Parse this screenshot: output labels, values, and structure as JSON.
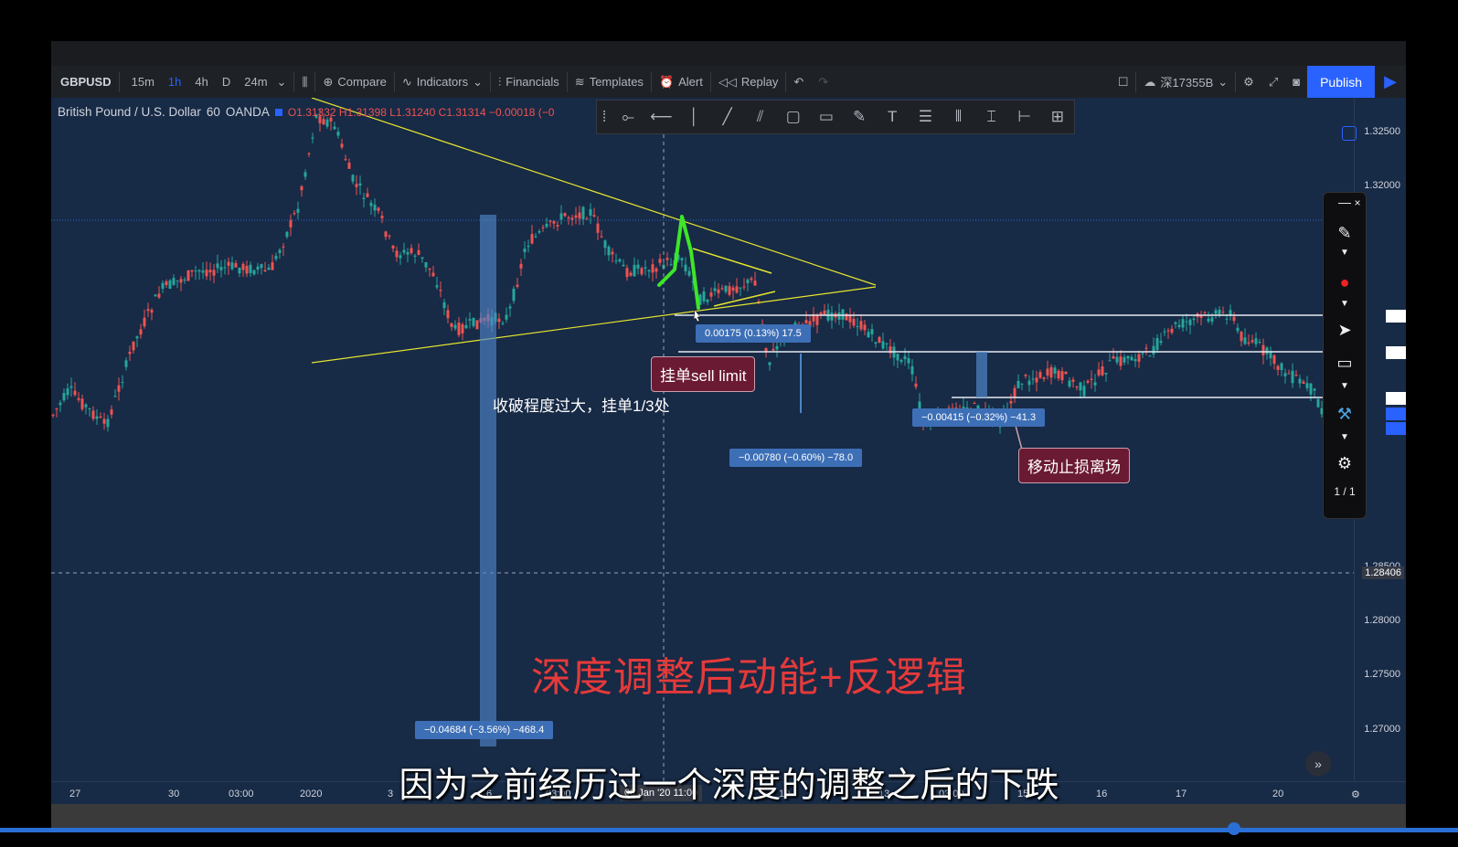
{
  "toolbar": {
    "symbol": "GBPUSD",
    "timeframes": [
      "15m",
      "1h",
      "4h",
      "D",
      "24m"
    ],
    "compare": "Compare",
    "indicators": "Indicators",
    "financials": "Financials",
    "templates": "Templates",
    "alert": "Alert",
    "replay": "Replay",
    "account": "深17355B",
    "publish": "Publish"
  },
  "legend": {
    "name": "British Pound / U.S. Dollar",
    "interval": "60",
    "source": "OANDA",
    "ohlc": "O1.31332  H1.31398  L1.31240  C1.31314  −0.00018 (−0"
  },
  "price_axis": [
    "1.32500",
    "1.32000",
    "1.28500",
    "1.28000",
    "1.27500",
    "1.27000"
  ],
  "crosshair_price": "1.28406",
  "time_axis": [
    "27",
    "30",
    "03:00",
    "2020",
    "3",
    "6",
    "03:00",
    "10",
    "13",
    "03:00",
    "15",
    "16",
    "17",
    "20"
  ],
  "crosshair_time": "08 Jan '20  11:00",
  "measurements": {
    "m1": "0.00175 (0.13%) 17.5",
    "m2": "−0.00780 (−0.60%) −78.0",
    "m3": "−0.00415 (−0.32%) −41.3",
    "m4": "−0.04684 (−3.56%) −468.4"
  },
  "annotations": {
    "sell_limit": "挂单sell limit",
    "breakout_note": "收破程度过大，挂单1/3处",
    "trailing_stop": "移动止损离场",
    "headline": "深度调整后动能+反逻辑"
  },
  "subtitle": "因为之前经历过一个深度的调整之后的下跌",
  "pen_panel": {
    "page": "1 / 1"
  },
  "colors": {
    "chart_bg": "#172a46",
    "up": "#26a69a",
    "down": "#ef5350",
    "accent": "#2962ff",
    "trendline": "#e6e62e",
    "headline": "#e53a3a"
  }
}
